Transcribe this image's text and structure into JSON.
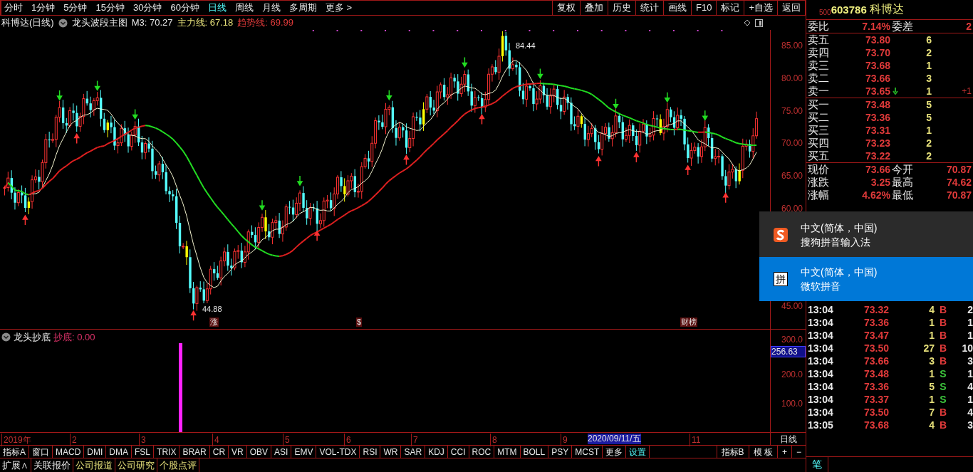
{
  "period_tabs": [
    {
      "label": "分时",
      "selected": false
    },
    {
      "label": "1分钟",
      "selected": false
    },
    {
      "label": "5分钟",
      "selected": false
    },
    {
      "label": "15分钟",
      "selected": false
    },
    {
      "label": "30分钟",
      "selected": false
    },
    {
      "label": "60分钟",
      "selected": false
    },
    {
      "label": "日线",
      "selected": true
    },
    {
      "label": "周线",
      "selected": false
    },
    {
      "label": "月线",
      "selected": false
    },
    {
      "label": "多周期",
      "selected": false
    },
    {
      "label": "更多 >",
      "selected": false
    }
  ],
  "tool_buttons": [
    "复权",
    "叠加",
    "历史",
    "统计",
    "画线",
    "F10",
    "标记",
    "+自选",
    "返回"
  ],
  "chart_title": {
    "security": "科博达(日线)",
    "formula": "龙头波段主图",
    "readings": [
      {
        "text": "M3: 70.27",
        "color": "#e8e8e8"
      },
      {
        "text": "主力线: 67.18",
        "color": "#e6e07a"
      },
      {
        "text": "趋势线: 69.99",
        "color": "#e03a3a"
      }
    ]
  },
  "price_axis": [
    "85.00",
    "80.00",
    "75.00",
    "70.00",
    "65.00",
    "60.00",
    "45.00"
  ],
  "price_notes": {
    "high": "84.44",
    "low": "44.88"
  },
  "chart_markers": [
    "涨",
    "$",
    "财榜"
  ],
  "indicator": {
    "name": "龙头抄底",
    "reading": "抄底: 0.00",
    "axis": [
      "300.0",
      "200.0",
      "100.0"
    ],
    "cursor_value": "256.63"
  },
  "date_axis": {
    "labels": [
      "2019年",
      "2",
      "3",
      "4",
      "5",
      "6",
      "7",
      "8",
      "9",
      "11"
    ],
    "cursor_date": "2020/09/11/五",
    "period": "日线"
  },
  "indicator_tabs": [
    {
      "label": "指标A",
      "accent": false
    },
    {
      "label": "窗口",
      "accent": false
    },
    {
      "label": "MACD",
      "accent": false
    },
    {
      "label": "DMI",
      "accent": false
    },
    {
      "label": "DMA",
      "accent": false
    },
    {
      "label": "FSL",
      "accent": false
    },
    {
      "label": "TRIX",
      "accent": false
    },
    {
      "label": "BRAR",
      "accent": false
    },
    {
      "label": "CR",
      "accent": false
    },
    {
      "label": "VR",
      "accent": false
    },
    {
      "label": "OBV",
      "accent": false
    },
    {
      "label": "ASI",
      "accent": false
    },
    {
      "label": "EMV",
      "accent": false
    },
    {
      "label": "VOL-TDX",
      "accent": false
    },
    {
      "label": "RSI",
      "accent": false
    },
    {
      "label": "WR",
      "accent": false
    },
    {
      "label": "SAR",
      "accent": false
    },
    {
      "label": "KDJ",
      "accent": false
    },
    {
      "label": "CCI",
      "accent": false
    },
    {
      "label": "ROC",
      "accent": false
    },
    {
      "label": "MTM",
      "accent": false
    },
    {
      "label": "BOLL",
      "accent": false
    },
    {
      "label": "PSY",
      "accent": false
    },
    {
      "label": "MCST",
      "accent": false
    },
    {
      "label": "更多",
      "accent": false
    },
    {
      "label": "设置",
      "accent": true
    }
  ],
  "indicator_tabs_right": [
    "指标B",
    "模 板",
    "+",
    "−"
  ],
  "bottom_tabs": [
    {
      "label": "扩展∧",
      "accent": false
    },
    {
      "label": "关联报价",
      "accent": false
    },
    {
      "label": "公司报道",
      "accent": true
    },
    {
      "label": "公司研究",
      "accent": true
    },
    {
      "label": "个股点评",
      "accent": true
    }
  ],
  "quote": {
    "lot": "500",
    "code": "603786",
    "name": "科博达"
  },
  "order_ratio": {
    "label": "委比",
    "value": "7.14%",
    "label2": "委差",
    "value2": "2"
  },
  "sell_orders": [
    {
      "label": "卖五",
      "price": "73.80",
      "volume": "6",
      "arrow_down": false
    },
    {
      "label": "卖四",
      "price": "73.70",
      "volume": "2",
      "arrow_down": false
    },
    {
      "label": "卖三",
      "price": "73.68",
      "volume": "1",
      "arrow_down": false
    },
    {
      "label": "卖二",
      "price": "73.66",
      "volume": "3",
      "arrow_down": false
    },
    {
      "label": "卖一",
      "price": "73.65",
      "volume": "1",
      "arrow_down": true,
      "change": "+1"
    }
  ],
  "buy_orders": [
    {
      "label": "买一",
      "price": "73.48",
      "volume": "5"
    },
    {
      "label": "买二",
      "price": "73.36",
      "volume": "5"
    },
    {
      "label": "买三",
      "price": "73.31",
      "volume": "1"
    },
    {
      "label": "买四",
      "price": "73.23",
      "volume": "2"
    },
    {
      "label": "买五",
      "price": "73.22",
      "volume": "2"
    }
  ],
  "stats": [
    {
      "label": "现价",
      "value": "73.66",
      "label2": "今开",
      "value2": "70.87"
    },
    {
      "label": "涨跌",
      "value": "3.25",
      "label2": "最高",
      "value2": "74.62"
    },
    {
      "label": "涨幅",
      "value": "4.62%",
      "label2": "最低",
      "value2": "70.87"
    }
  ],
  "ime_menu": [
    {
      "title": "中文(简体，中国)",
      "subtitle": "搜狗拼音输入法",
      "kind": "logo",
      "selected": false
    },
    {
      "title": "中文(简体，中国)",
      "subtitle": "微软拼音",
      "kind": "glyph",
      "glyph": "拼",
      "selected": true
    }
  ],
  "trades": [
    {
      "time": "13:04",
      "price": "73.32",
      "volume": "4",
      "side": "B",
      "color": "#e03a3a",
      "count": "2"
    },
    {
      "time": "13:04",
      "price": "73.36",
      "volume": "1",
      "side": "B",
      "color": "#e03a3a",
      "count": "1"
    },
    {
      "time": "13:04",
      "price": "73.47",
      "volume": "1",
      "side": "B",
      "color": "#e03a3a",
      "count": "1"
    },
    {
      "time": "13:04",
      "price": "73.50",
      "volume": "27",
      "side": "B",
      "color": "#e03a3a",
      "count": "10"
    },
    {
      "time": "13:04",
      "price": "73.66",
      "volume": "3",
      "side": "B",
      "color": "#e03a3a",
      "count": "3"
    },
    {
      "time": "13:04",
      "price": "73.48",
      "volume": "1",
      "side": "S",
      "color": "#3cc43c",
      "count": "1"
    },
    {
      "time": "13:04",
      "price": "73.36",
      "volume": "5",
      "side": "S",
      "color": "#3cc43c",
      "count": "4"
    },
    {
      "time": "13:04",
      "price": "73.37",
      "volume": "1",
      "side": "S",
      "color": "#3cc43c",
      "count": "1"
    },
    {
      "time": "13:04",
      "price": "73.50",
      "volume": "7",
      "side": "B",
      "color": "#e03a3a",
      "count": "4"
    },
    {
      "time": "13:05",
      "price": "73.68",
      "volume": "4",
      "side": "B",
      "color": "#e03a3a",
      "count": "3"
    }
  ],
  "trade_tabs": [
    "笔"
  ]
}
